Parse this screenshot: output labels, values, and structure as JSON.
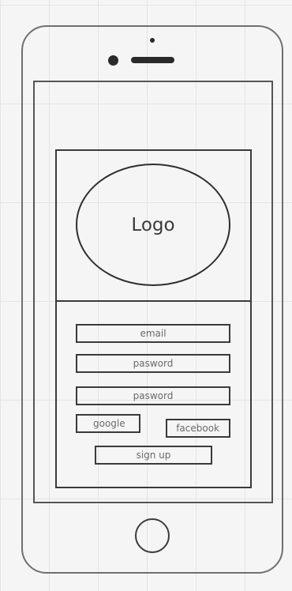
{
  "logo": {
    "text": "Logo"
  },
  "form": {
    "email_placeholder": "email",
    "password_placeholder": "pasword",
    "password_confirm_placeholder": "pasword",
    "google_label": "google",
    "facebook_label": "facebook",
    "signup_label": "sign up"
  }
}
